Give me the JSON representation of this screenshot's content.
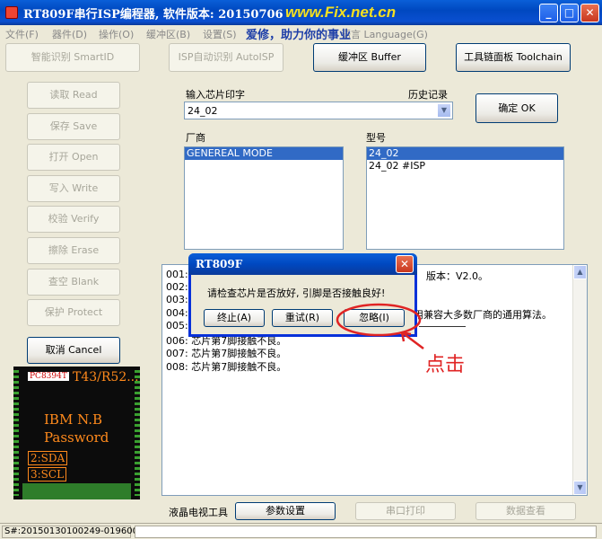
{
  "window": {
    "title": "RT809F串行ISP编程器, 软件版本: 20150706",
    "watermark": "www.Fix.net.cn",
    "min": "_",
    "max": "□",
    "close": "✕"
  },
  "menu": {
    "items": [
      "文件(F)",
      "器件(D)",
      "操作(O)",
      "缓冲区(B)",
      "设置(S)",
      "语言 Language(G)"
    ],
    "slogan": "爱修，助力你的事业"
  },
  "toolbar": {
    "smartid": "智能识别 SmartID",
    "autoisp": "ISP自动识别 AutoISP",
    "buffer": "缓冲区 Buffer",
    "toolchain": "工具链面板 Toolchain"
  },
  "side": {
    "read": "读取 Read",
    "save": "保存 Save",
    "open": "打开 Open",
    "write": "写入 Write",
    "verify": "校验 Verify",
    "erase": "擦除 Erase",
    "blank": "查空 Blank",
    "protect": "保护 Protect",
    "cancel": "取消 Cancel"
  },
  "chip": {
    "tag": "PC8394T",
    "model": "T43/R52...",
    "line1": "IBM N.B",
    "line2": "Password",
    "sda": "2:SDA",
    "scl": "3:SCL"
  },
  "chipinput": {
    "label": "输入芯片印字",
    "history": "历史记录",
    "value": "24_02",
    "ok": "确定 OK"
  },
  "vendor": {
    "label": "厂商",
    "items": [
      "GENEREAL MODE"
    ]
  },
  "model": {
    "label": "型号",
    "items": [
      "24_02",
      "24_02 #ISP"
    ]
  },
  "log": {
    "lines": [
      "001:",
      "002:",
      "003:",
      "004:",
      "005:",
      "006: 芯片第7脚接触不良。",
      "007: 芯片第7脚接触不良。",
      "008: 芯片第7脚接触不良。"
    ],
    "frag1": "版本：V2.0。",
    "frag4": "用兼容大多数厂商的通用算法。"
  },
  "dialog": {
    "title": "RT809F",
    "message": "请检查芯片是否放好, 引脚是否接触良好!",
    "abort": "终止(A)",
    "retry": "重试(R)",
    "ignore": "忽略(I)"
  },
  "annotation": "点击",
  "bottom": {
    "lcdtools": "液晶电视工具",
    "params": "参数设置",
    "serialprint": "串口打印",
    "dataview": "数据查看"
  },
  "status": {
    "serial": "S#:20150130100249-019600"
  }
}
